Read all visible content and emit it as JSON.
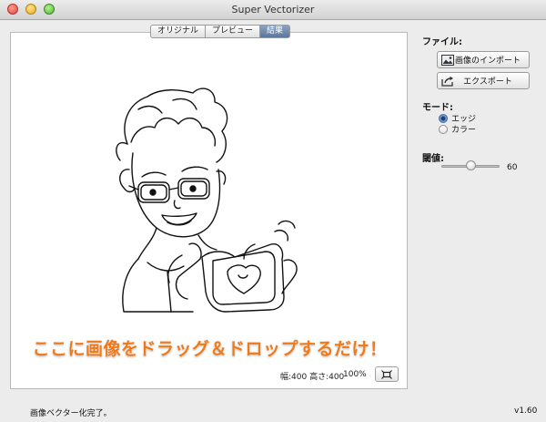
{
  "window": {
    "title": "Super Vectorizer"
  },
  "tabs": [
    {
      "label": "オリジナル",
      "active": false
    },
    {
      "label": "プレビュー",
      "active": false
    },
    {
      "label": "結果",
      "active": true
    }
  ],
  "canvas": {
    "drop_hint": "ここに画像をドラッグ＆ドロップするだけ！",
    "size_info": "幅:400 高さ:400",
    "zoom": "100%"
  },
  "sidebar": {
    "file_label": "ファイル:",
    "import_button": "画像のインポート",
    "export_button": "エクスポート",
    "mode_label": "モード:",
    "mode_options": [
      {
        "label": "エッジ",
        "selected": true
      },
      {
        "label": "カラー",
        "selected": false
      }
    ],
    "threshold_label": "閾値:",
    "threshold_value": "60",
    "threshold_fraction": 0.5
  },
  "status": {
    "message": "画像ベクター化完了。",
    "version": "v1.60"
  },
  "colors": {
    "accent_orange": "#f07a1a",
    "tab_active": "#5a7799"
  }
}
